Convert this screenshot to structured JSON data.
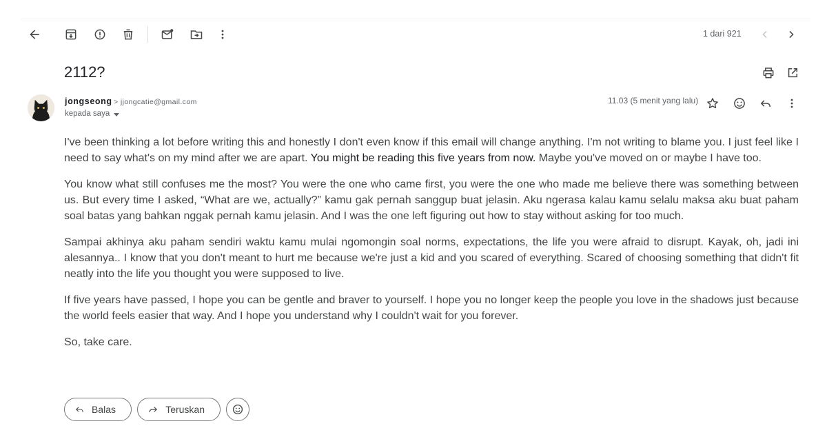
{
  "toolbar": {
    "pager": "1 dari 921",
    "icons": [
      "back-arrow-icon",
      "archive-icon",
      "report-spam-icon",
      "delete-icon",
      "mark-unread-icon",
      "move-to-icon",
      "more-vertical-icon",
      "chevron-left-icon",
      "chevron-right-icon"
    ]
  },
  "email": {
    "subject": "2112?",
    "sender_name": "jongseong",
    "sender_email": "> jjongcatie@gmail.com",
    "to_line": "kepada saya",
    "timestamp": "11.03 (5 menit yang lalu)",
    "paragraphs": [
      {
        "before": "I've been thinking a lot before writing this and honestly I don't even know if this email will change anything. I'm not writing to blame you. I just feel like I need to say what's on my mind after we are apart. ",
        "highlight": "You might be reading this five years from now.",
        "after": " Maybe you've moved on or maybe I have too."
      },
      {
        "text": "You know what still confuses me the most? You were the one who came first, you were the one who made me believe there was something between us. But every time I asked, “What are we, actually?” kamu gak pernah sanggup buat jelasin. Aku ngerasa kalau kamu selalu maksa aku buat paham soal batas yang bahkan nggak pernah kamu jelasin. And I was the one left figuring out how to stay without asking for too much."
      },
      {
        "text": "Sampai akhinya aku paham sendiri waktu kamu mulai ngomongin soal norms, expectations, the life you were afraid to disrupt. Kayak, oh, jadi ini alesannya.. I know that you don't meant to hurt me because we're just a kid and you scared of everything. Scared of choosing something that didn't fit neatly into the life you thought you were supposed to live."
      },
      {
        "text": "If five years have passed, I hope you can be gentle and braver to yourself. I hope you no longer keep the people you love in the shadows just because the world feels easier that way. And I hope you understand why I couldn't wait for you forever."
      },
      {
        "text": "So, take care."
      }
    ]
  },
  "reply_bar": {
    "reply_label": "Balas",
    "forward_label": "Teruskan"
  }
}
